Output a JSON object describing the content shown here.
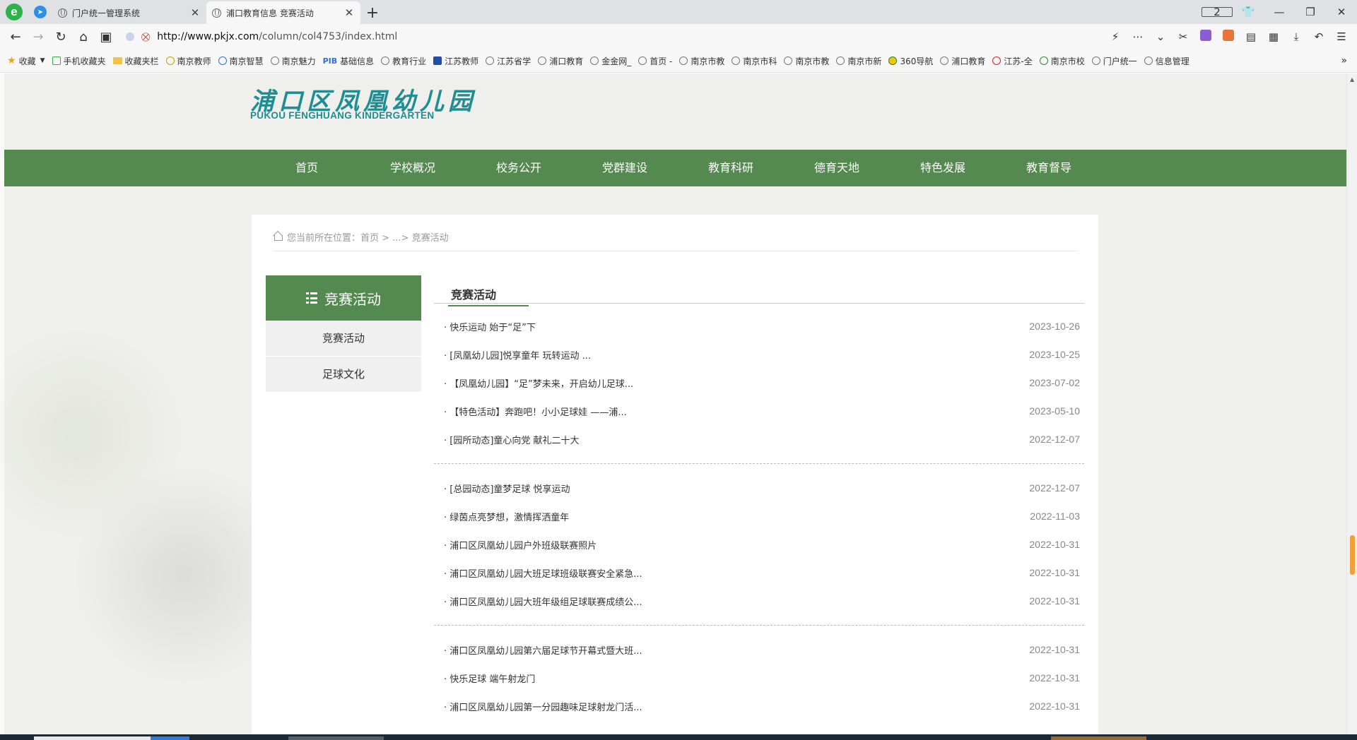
{
  "browser": {
    "tabs": [
      {
        "title": "门户统一管理系统"
      },
      {
        "title": "浦口教育信息 竞赛活动"
      }
    ],
    "tab_count": "2",
    "url_host": "http://www.pkjx.com",
    "url_path": "/column/col4753/index.html",
    "bookmarks": [
      "收藏",
      "手机收藏夹",
      "收藏夹栏",
      "南京教师",
      "南京智慧",
      "南京魅力",
      "基础信息",
      "教育行业",
      "江苏教师",
      "江苏省学",
      "浦口教育",
      "金金网_",
      "首页 -",
      "南京市教",
      "南京市科",
      "南京市教",
      "南京市新",
      "360导航",
      "浦口教育",
      "江苏-全",
      "南京市校",
      "门户统一",
      "信息管理"
    ]
  },
  "site": {
    "logo_cn": "浦口区凤凰幼儿园",
    "logo_en": "PUKOU FENGHUANG KINDERGARTEN",
    "nav": [
      "首页",
      "学校概况",
      "校务公开",
      "党群建设",
      "教育科研",
      "德育天地",
      "特色发展",
      "教育督导"
    ]
  },
  "breadcrumb": "您当前所在位置：首页 > ...> 竞赛活动",
  "sidebar": {
    "heading": "竞赛活动",
    "items": [
      "竞赛活动",
      "足球文化"
    ]
  },
  "list": {
    "heading": "竞赛活动",
    "groups": [
      [
        {
          "title": "快乐运动 始于“足”下",
          "date": "2023-10-26"
        },
        {
          "title": "[凤凰幼儿园]悦享童年 玩转运动 ...",
          "date": "2023-10-25"
        },
        {
          "title": "【凤凰幼儿园】“足”梦未来，开启幼儿足球...",
          "date": "2023-07-02"
        },
        {
          "title": "【特色活动】奔跑吧！小小足球娃 ——浦...",
          "date": "2023-05-10"
        },
        {
          "title": "[园所动态]童心向党 献礼二十大",
          "date": "2022-12-07"
        }
      ],
      [
        {
          "title": "[总园动态]童梦足球 悦享运动",
          "date": "2022-12-07"
        },
        {
          "title": "绿茵点亮梦想，激情挥洒童年",
          "date": "2022-11-03"
        },
        {
          "title": "浦口区凤凰幼儿园户外班级联赛照片",
          "date": "2022-10-31"
        },
        {
          "title": "浦口区凤凰幼儿园大班足球班级联赛安全紧急...",
          "date": "2022-10-31"
        },
        {
          "title": "浦口区凤凰幼儿园大班年级组足球联赛成绩公...",
          "date": "2022-10-31"
        }
      ],
      [
        {
          "title": "浦口区凤凰幼儿园第六届足球节开幕式暨大班...",
          "date": "2022-10-31"
        },
        {
          "title": "快乐足球 端午射龙门",
          "date": "2022-10-31"
        },
        {
          "title": "浦口区凤凰幼儿园第一分园趣味足球射龙门活...",
          "date": "2022-10-31"
        }
      ]
    ]
  },
  "colors": {
    "brand_green": "#548950",
    "logo_teal": "#1e8e93"
  }
}
